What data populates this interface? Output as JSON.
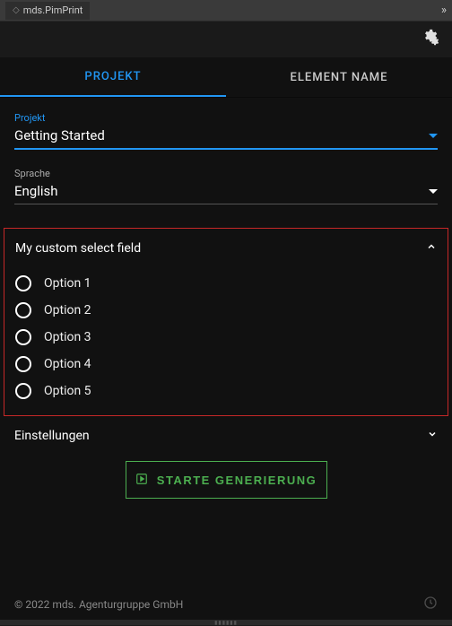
{
  "header": {
    "title": "mds.PimPrint"
  },
  "tabs": {
    "projekt": "PROJEKT",
    "element_name": "ELEMENT NAME"
  },
  "project_field": {
    "label": "Projekt",
    "value": "Getting Started"
  },
  "language_field": {
    "label": "Sprache",
    "value": "English"
  },
  "custom_select": {
    "title": "My custom select field",
    "options": [
      "Option 1",
      "Option 2",
      "Option 3",
      "Option 4",
      "Option 5"
    ]
  },
  "settings": {
    "label": "Einstellungen"
  },
  "generate_button": {
    "label": "STARTE GENERIERUNG"
  },
  "footer": {
    "copyright": "© 2022 mds. Agenturgruppe GmbH"
  }
}
